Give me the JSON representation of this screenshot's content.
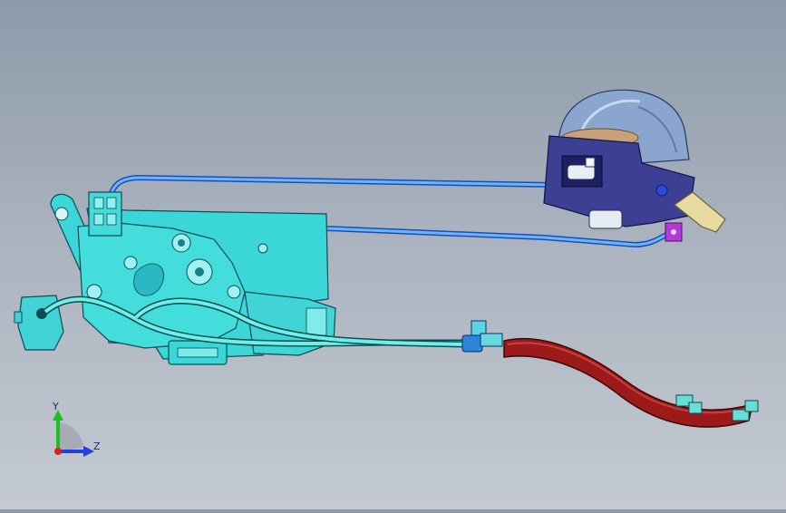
{
  "viewport": {
    "background_top": "#8e9aaa",
    "background_bottom": "#c5cad2"
  },
  "model": {
    "lock_body_color": "#38d6d6",
    "cable_color_blue": "#2f7fe0",
    "cable_color_cyan": "#3fd7cf",
    "sheath_color": "#9a1818",
    "actuator_housing_color": "#3a3a8c",
    "actuator_dome_color": "#7f9fc9",
    "bracket_color": "#e6d8a0",
    "clip_color": "#b13bd6"
  },
  "triad": {
    "y_label": "Y",
    "z_label": "Z",
    "y_axis_color": "#1fbf1f",
    "z_axis_color": "#1f3fdf",
    "origin_color": "#e02020"
  }
}
